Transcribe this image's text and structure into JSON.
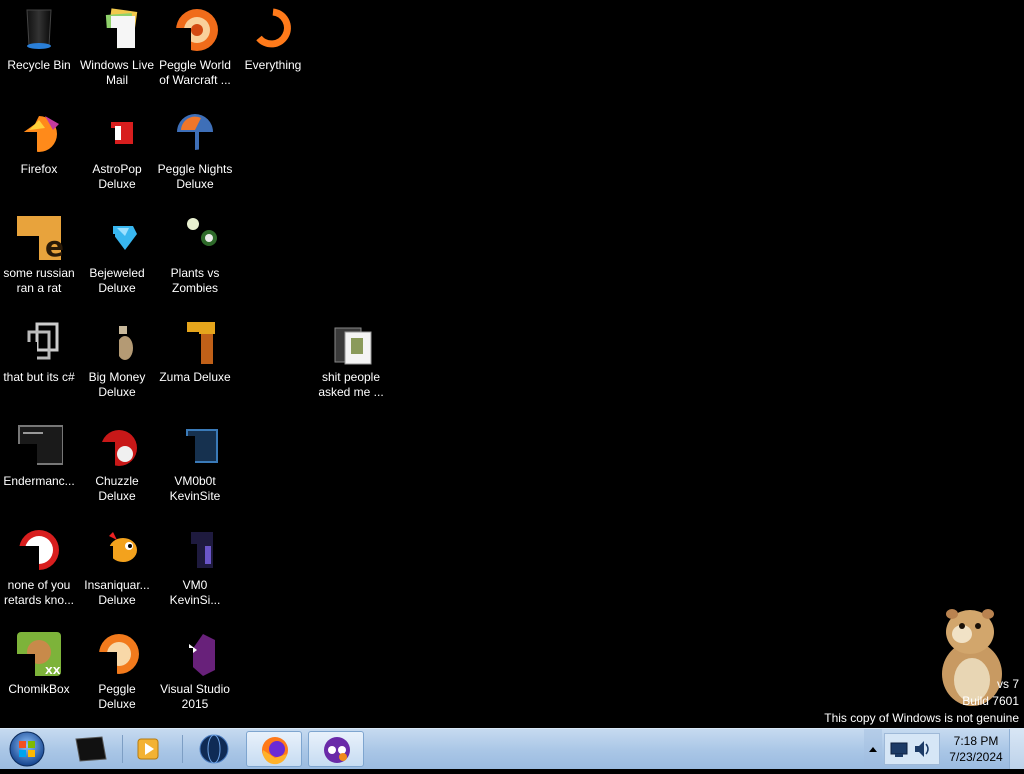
{
  "desktop": {
    "icons": [
      {
        "label": "Recycle Bin",
        "icon": "recycle-bin-icon"
      },
      {
        "label": "Windows Live\nMail",
        "icon": "mail-icon"
      },
      {
        "label": "Peggle World\nof Warcraft ...",
        "icon": "peggle-icon"
      },
      {
        "label": "Everything",
        "icon": "everything-search-icon"
      },
      {
        "label": "Firefox",
        "icon": "firefox-icon"
      },
      {
        "label": "AstroPop\nDeluxe",
        "icon": "astropop-icon"
      },
      {
        "label": "Peggle Nights\nDeluxe",
        "icon": "peggle-nights-icon"
      },
      {
        "label": "some russian\nran a rat",
        "icon": "app-shortcut-icon"
      },
      {
        "label": "Bejeweled\nDeluxe",
        "icon": "bejeweled-icon"
      },
      {
        "label": "Plants vs\nZombies",
        "icon": "plants-vs-zombies-icon"
      },
      {
        "label": "that but its c#",
        "icon": "folder-stack-icon"
      },
      {
        "label": "Big Money\nDeluxe",
        "icon": "big-money-icon"
      },
      {
        "label": "Zuma Deluxe",
        "icon": "zuma-icon"
      },
      {
        "label": "shit people\nasked me ...",
        "icon": "folder-icon"
      },
      {
        "label": "Endermanc...",
        "icon": "terminal-icon"
      },
      {
        "label": "Chuzzle\nDeluxe",
        "icon": "chuzzle-icon"
      },
      {
        "label": "VM0b0t\nKevinSite",
        "icon": "vm-icon"
      },
      {
        "label": "none of you\nretards kno...",
        "icon": "app-shortcut-icon"
      },
      {
        "label": "Insaniquar...\nDeluxe",
        "icon": "insaniquarium-icon"
      },
      {
        "label": "VM0\nKevinSi...",
        "icon": "vm-file-icon"
      },
      {
        "label": "ChomikBox",
        "icon": "chomikbox-icon"
      },
      {
        "label": "Peggle Deluxe",
        "icon": "peggle-deluxe-icon"
      },
      {
        "label": "Visual Studio\n2015",
        "icon": "visual-studio-icon"
      }
    ]
  },
  "watermark": {
    "line1": "vs 7",
    "line2": "Build 7601",
    "line3": "This copy of Windows is not genuine"
  },
  "taskbar": {
    "start_icon": "windows-logo-icon",
    "pinned": [
      "terminal-icon",
      "media-player-icon",
      "globe-icon",
      "firefox-icon",
      "obs-mask-icon"
    ],
    "clock": {
      "time": "7:18 PM",
      "date": "7/23/2024"
    }
  }
}
